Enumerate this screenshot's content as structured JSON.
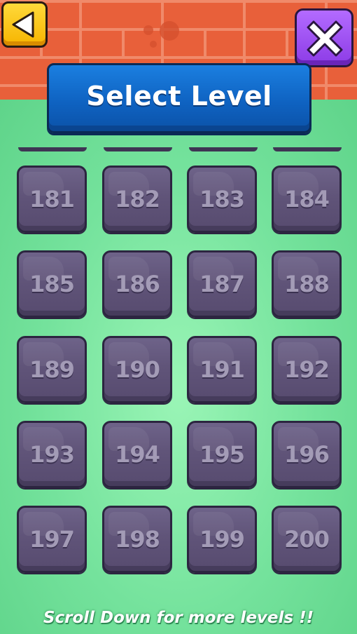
{
  "header": {
    "title": "Select Level",
    "back_icon": "back-arrow-icon",
    "close_icon": "close-x-icon"
  },
  "colors": {
    "wall": "#e8603a",
    "board": "#6ee39a",
    "back_button": "#ffc61a",
    "close_button": "#a052f5",
    "title_banner": "#1370d2",
    "level_button": "#605479",
    "level_text": "#a39bb6"
  },
  "levels": [
    "181",
    "182",
    "183",
    "184",
    "185",
    "186",
    "187",
    "188",
    "189",
    "190",
    "191",
    "192",
    "193",
    "194",
    "195",
    "196",
    "197",
    "198",
    "199",
    "200"
  ],
  "footer": {
    "hint": "Scroll Down for more levels !!"
  }
}
